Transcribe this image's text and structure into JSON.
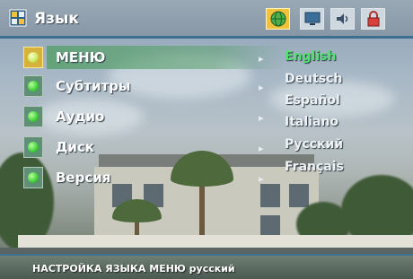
{
  "header": {
    "title": "Язык",
    "tabs": [
      {
        "icon": "globe-icon",
        "active": true
      },
      {
        "icon": "monitor-icon",
        "active": false
      },
      {
        "icon": "speaker-icon",
        "active": false
      },
      {
        "icon": "lock-icon",
        "active": false
      }
    ]
  },
  "menu": {
    "items": [
      {
        "label": "МЕНЮ",
        "active": true
      },
      {
        "label": "Субтитры",
        "active": false
      },
      {
        "label": "Аудио",
        "active": false
      },
      {
        "label": "Диск",
        "active": false
      },
      {
        "label": "Версия",
        "active": false
      }
    ]
  },
  "options": {
    "items": [
      {
        "label": "English",
        "selected": true
      },
      {
        "label": "Deutsch",
        "selected": false
      },
      {
        "label": "Español",
        "selected": false
      },
      {
        "label": "Italiano",
        "selected": false
      },
      {
        "label": "Русский",
        "selected": false
      },
      {
        "label": "Français",
        "selected": false
      }
    ]
  },
  "status": {
    "text": "НАСТРОЙКА ЯЗЫКА МЕНЮ русский"
  },
  "colors": {
    "tab_active": "#f3c13a",
    "selected_option": "#4ee36e",
    "accent_line": "#3d6f8e"
  }
}
